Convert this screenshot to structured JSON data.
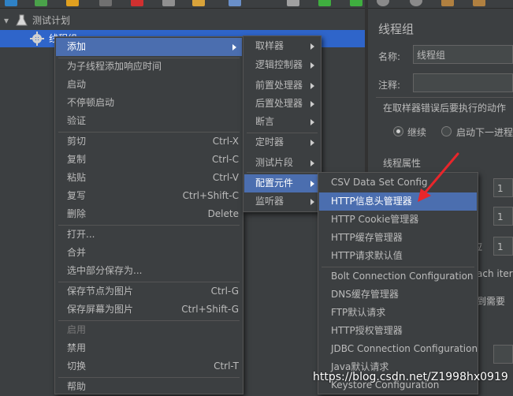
{
  "tree": {
    "root_label": "测试计划",
    "thread_group_label": "线程组"
  },
  "right_panel": {
    "title": "线程组",
    "name_label": "名称:",
    "name_value": "线程组",
    "comment_label": "注释:",
    "error_action_label": "在取样器错误后要执行的动作",
    "radio_continue": "继续",
    "radio_next_loop": "启动下一进程",
    "thread_props_label": "线程属性",
    "field1_value": "1",
    "field2_value": "1",
    "field3_value": "1",
    "partial_label_1": "应",
    "partial_label_2": "ach itera",
    "partial_label_3": "到需要"
  },
  "context_menu": {
    "items": [
      {
        "label": "添加"
      },
      {
        "label": "为子线程添加响应时间"
      },
      {
        "label": "启动"
      },
      {
        "label": "不停顿启动"
      },
      {
        "label": "验证"
      },
      {
        "label": "剪切",
        "shortcut": "Ctrl-X"
      },
      {
        "label": "复制",
        "shortcut": "Ctrl-C"
      },
      {
        "label": "粘贴",
        "shortcut": "Ctrl-V"
      },
      {
        "label": "复写",
        "shortcut": "Ctrl+Shift-C"
      },
      {
        "label": "删除",
        "shortcut": "Delete"
      },
      {
        "label": "打开..."
      },
      {
        "label": "合并"
      },
      {
        "label": "选中部分保存为..."
      },
      {
        "label": "保存节点为图片",
        "shortcut": "Ctrl-G"
      },
      {
        "label": "保存屏幕为图片",
        "shortcut": "Ctrl+Shift-G"
      },
      {
        "label": "启用"
      },
      {
        "label": "禁用"
      },
      {
        "label": "切换",
        "shortcut": "Ctrl-T"
      },
      {
        "label": "帮助"
      }
    ]
  },
  "add_submenu": {
    "items": [
      {
        "label": "取样器"
      },
      {
        "label": "逻辑控制器"
      },
      {
        "label": "前置处理器"
      },
      {
        "label": "后置处理器"
      },
      {
        "label": "断言"
      },
      {
        "label": "定时器"
      },
      {
        "label": "测试片段"
      },
      {
        "label": "配置元件"
      },
      {
        "label": "监听器"
      }
    ]
  },
  "config_submenu": {
    "items": [
      {
        "label": "CSV Data Set Config"
      },
      {
        "label": "HTTP信息头管理器"
      },
      {
        "label": "HTTP Cookie管理器"
      },
      {
        "label": "HTTP缓存管理器"
      },
      {
        "label": "HTTP请求默认值"
      },
      {
        "label": "Bolt Connection Configuration"
      },
      {
        "label": "DNS缓存管理器"
      },
      {
        "label": "FTP默认请求"
      },
      {
        "label": "HTTP授权管理器"
      },
      {
        "label": "JDBC Connection Configuration"
      },
      {
        "label": "Java默认请求"
      },
      {
        "label": "Keystore Configuration"
      }
    ]
  },
  "watermark": "https://blog.csdn.net/Z1998hx0919",
  "colors": {
    "highlight": "#4b6eaf",
    "selection": "#2f65ca",
    "arrow": "#e8262b"
  }
}
